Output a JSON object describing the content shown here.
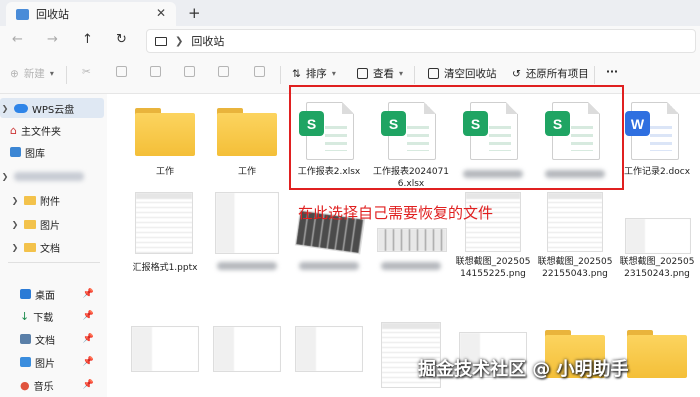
{
  "window": {
    "tab_label": "回收站",
    "tab_close": "✕",
    "new_tab": "+"
  },
  "address": {
    "path_label": "回收站"
  },
  "toolbar": {
    "new_label": "新建",
    "sort_label": "排序",
    "view_label": "查看",
    "empty_label": "清空回收站",
    "restore_all_label": "还原所有项目",
    "more_label": "···"
  },
  "sidebar": {
    "wps_cloud": "WPS云盘",
    "home": "主文件夹",
    "gallery": "图库",
    "attachments": "附件",
    "pictures": "图片",
    "documents": "文档",
    "desktop": "桌面",
    "downloads": "下载",
    "docs_quick": "文档",
    "pics_quick": "图片",
    "music": "音乐"
  },
  "files": {
    "folder1": "工作",
    "folder2": "工作",
    "xlsx1": "工作报表2.xlsx",
    "xlsx2": "工作报表20240716.xlsx",
    "docx1": "工作记录2.docx",
    "pptx1": "汇报格式1.pptx",
    "png1": "联想截图_20250514155225.png",
    "png2": "联想截图_20250522155043.png",
    "png3": "联想截图_20250523150243.png"
  },
  "annotation": "在此选择自己需要恢复的文件",
  "watermark": "掘金技术社区 @ 小明助手",
  "colors": {
    "annotation_red": "#e02020",
    "excel_green": "#1fa463",
    "word_blue": "#2f6fe0",
    "folder_yellow": "#f4bf38"
  }
}
